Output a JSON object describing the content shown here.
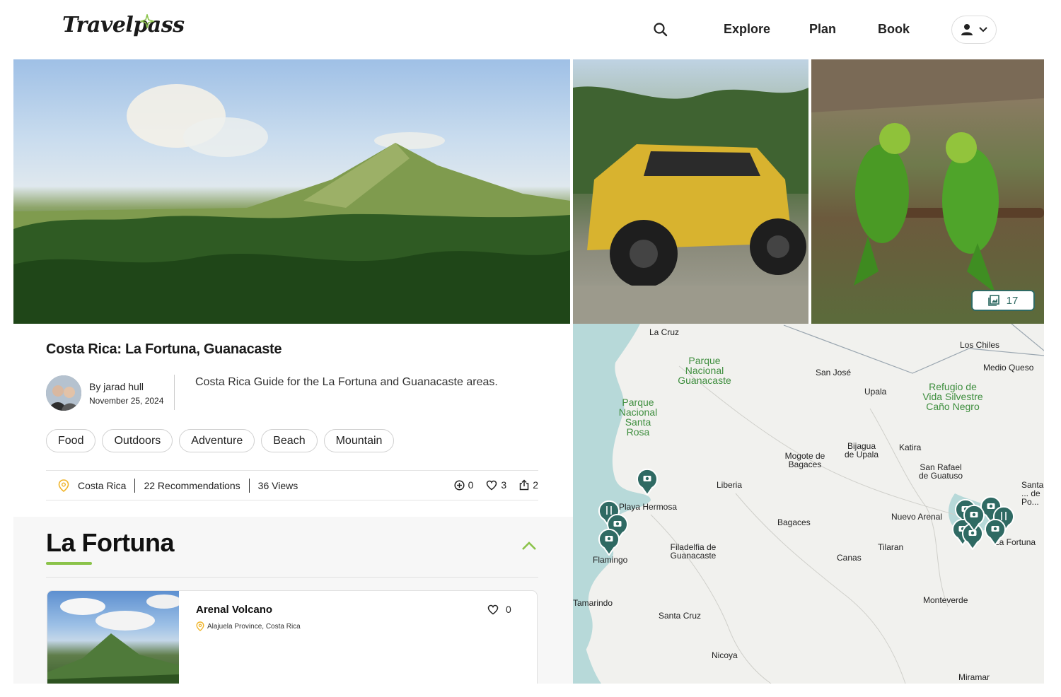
{
  "header": {
    "logo": "Travelpass",
    "nav": [
      {
        "label": "Explore"
      },
      {
        "label": "Plan"
      },
      {
        "label": "Book"
      }
    ]
  },
  "gallery": {
    "photo_count": "17"
  },
  "guide": {
    "title": "Costa Rica: La Fortuna, Guanacaste",
    "author": "By jarad hull",
    "date": "November 25, 2024",
    "description": "Costa Rica Guide for the La Fortuna and Guanacaste areas.",
    "tags": [
      "Food",
      "Outdoors",
      "Adventure",
      "Beach",
      "Mountain"
    ],
    "location": "Costa Rica",
    "recommendations": "22 Recommendations",
    "views": "36 Views",
    "adds": "0",
    "likes": "3",
    "shares": "2"
  },
  "section": {
    "title": "La Fortuna",
    "card": {
      "title": "Arenal Volcano",
      "location": "Alajuela Province, Costa Rica",
      "likes": "0"
    }
  },
  "map": {
    "places": [
      "La Cruz",
      "Los Chiles",
      "Medio Queso",
      "San José",
      "Upala",
      "Bijagua de Upala",
      "Katira",
      "Mogote de Bagaces",
      "San Rafael de Guatuso",
      "Liberia",
      "Playa Hermosa",
      "Bagaces",
      "Nuevo Arenal",
      "Flamingo",
      "Filadelfia de Guanacaste",
      "Tilaran",
      "Canas",
      "La Fortuna",
      "Tamarindo",
      "Monteverde",
      "Santa Cruz",
      "Nicoya",
      "Miramar",
      "Santa ... de Po..."
    ],
    "parks": [
      "Parque Nacional Guanacaste",
      "Parque Nacional Santa Rosa",
      "Refugio de Vida Silvestre Caño Negro"
    ]
  },
  "colors": {
    "accent_green": "#8bc34a",
    "pin_teal": "#2f6a63",
    "park_green": "#3e8e3e"
  }
}
